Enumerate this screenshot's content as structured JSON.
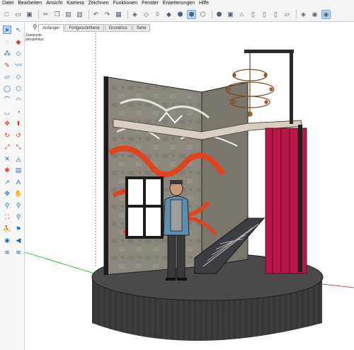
{
  "menu": [
    "Datei",
    "Bearbeiten",
    "Ansicht",
    "Kamera",
    "Zeichnen",
    "Funktionen",
    "Fenster",
    "Erweiterungen",
    "Hilfe"
  ],
  "toolbar": {
    "buttons": [
      {
        "icon": "new-file-icon",
        "glyph": "□",
        "active": false
      },
      {
        "icon": "open-folder-icon",
        "glyph": "▭",
        "active": false
      },
      {
        "icon": "save-icon",
        "glyph": "▣",
        "active": false
      },
      {
        "sep": true
      },
      {
        "icon": "cut-icon",
        "glyph": "✂",
        "active": false
      },
      {
        "icon": "copy-icon",
        "glyph": "❐",
        "active": false
      },
      {
        "icon": "paste-icon",
        "glyph": "▤",
        "active": false
      },
      {
        "icon": "erase-icon",
        "glyph": "▥",
        "active": false
      },
      {
        "sep": true
      },
      {
        "icon": "undo-icon",
        "glyph": "↶",
        "active": false
      },
      {
        "icon": "redo-icon",
        "glyph": "↷",
        "active": false
      },
      {
        "icon": "print-icon",
        "glyph": "▦",
        "active": false
      },
      {
        "sep": true
      },
      {
        "icon": "xray-icon",
        "glyph": "◈",
        "active": false
      },
      {
        "icon": "back-edges-icon",
        "glyph": "◇",
        "active": false
      },
      {
        "icon": "wireframe-icon",
        "glyph": "◊",
        "active": false
      },
      {
        "icon": "hidden-line-icon",
        "glyph": "◆",
        "active": false
      },
      {
        "icon": "shaded-icon",
        "glyph": "⬢",
        "active": false
      },
      {
        "icon": "shaded-textures-icon",
        "glyph": "⬢",
        "active": true
      },
      {
        "icon": "monochrome-icon",
        "glyph": "⬡",
        "active": false
      },
      {
        "sep": true
      },
      {
        "icon": "iso-view-icon",
        "glyph": "⬢",
        "active": false
      },
      {
        "icon": "top-view-icon",
        "glyph": "▣",
        "active": false
      },
      {
        "icon": "front-view-icon",
        "glyph": "⌂",
        "active": false
      },
      {
        "icon": "right-view-icon",
        "glyph": "▯",
        "active": false
      },
      {
        "icon": "back-view-icon",
        "glyph": "▯",
        "active": false
      },
      {
        "icon": "left-view-icon",
        "glyph": "▯",
        "active": false
      },
      {
        "icon": "bottom-view-icon",
        "glyph": "▱",
        "active": false
      },
      {
        "sep": true
      },
      {
        "icon": "section-plane-icon",
        "glyph": "◈",
        "active": false
      },
      {
        "icon": "section-cut-icon",
        "glyph": "◉",
        "active": false
      },
      {
        "icon": "section-fill-icon",
        "glyph": "◉",
        "active": true
      }
    ]
  },
  "left_tools": [
    {
      "icon": "select-arrow-icon",
      "glyph": "➤",
      "active": true
    },
    {
      "icon": "select-arrow-alt-icon",
      "glyph": "↖",
      "active": false
    },
    {
      "icon": "lasso-icon",
      "glyph": "◌",
      "active": false
    },
    {
      "icon": "paint-bucket-icon",
      "glyph": "◆",
      "active": false,
      "red": true
    },
    {
      "icon": "component-icon",
      "glyph": "⁂",
      "active": false
    },
    {
      "icon": "eraser-icon",
      "glyph": "◇",
      "active": false
    },
    {
      "icon": "pencil-icon",
      "glyph": "✎",
      "active": false,
      "red": true
    },
    {
      "icon": "freehand-icon",
      "glyph": "〰",
      "active": false
    },
    {
      "icon": "rectangle-icon",
      "glyph": "▱",
      "active": false
    },
    {
      "icon": "rotated-rect-icon",
      "glyph": "◇",
      "active": false
    },
    {
      "icon": "circle-icon",
      "glyph": "◯",
      "active": false
    },
    {
      "icon": "polygon-icon",
      "glyph": "⬡",
      "active": false
    },
    {
      "icon": "arc-icon",
      "glyph": "⌒",
      "active": false
    },
    {
      "icon": "arc-2pt-icon",
      "glyph": "◠",
      "active": false
    },
    {
      "icon": "arc-3pt-icon",
      "glyph": "◡",
      "active": false
    },
    {
      "icon": "pie-icon",
      "glyph": "◔",
      "active": false
    },
    {
      "icon": "move-icon",
      "glyph": "✥",
      "active": false,
      "red": true
    },
    {
      "icon": "push-pull-icon",
      "glyph": "⬆",
      "active": false,
      "red": true
    },
    {
      "icon": "rotate-icon",
      "glyph": "↻",
      "active": false,
      "red": true
    },
    {
      "icon": "follow-me-icon",
      "glyph": "↺",
      "active": false,
      "red": true
    },
    {
      "icon": "scale-icon",
      "glyph": "⤢",
      "active": false,
      "red": true
    },
    {
      "icon": "offset-icon",
      "glyph": "⤡",
      "active": false,
      "red": true
    },
    {
      "icon": "tape-measure-icon",
      "glyph": "✕",
      "active": false
    },
    {
      "icon": "protractor-icon",
      "glyph": "◬",
      "active": false
    },
    {
      "icon": "dimension-icon",
      "glyph": "✱",
      "active": false,
      "red": true
    },
    {
      "icon": "text-icon",
      "glyph": "▤",
      "active": false
    },
    {
      "icon": "axes-icon",
      "glyph": "↗",
      "active": false
    },
    {
      "icon": "3d-text-icon",
      "glyph": "A",
      "active": false
    },
    {
      "icon": "orbit-icon",
      "glyph": "✥",
      "active": false
    },
    {
      "icon": "pan-icon",
      "glyph": "✋",
      "active": false
    },
    {
      "icon": "zoom-icon",
      "glyph": "⚲",
      "active": false
    },
    {
      "icon": "zoom-window-icon",
      "glyph": "⚲",
      "active": false
    },
    {
      "icon": "zoom-extents-icon",
      "glyph": "⛶",
      "active": false,
      "red": true
    },
    {
      "icon": "previous-view-icon",
      "glyph": "⚲",
      "active": false
    },
    {
      "icon": "position-camera-icon",
      "glyph": "⛹",
      "active": false
    },
    {
      "icon": "walk-icon",
      "glyph": "⚑",
      "active": false
    },
    {
      "icon": "look-around-icon",
      "glyph": "◉",
      "active": false
    },
    {
      "icon": "section-icon",
      "glyph": "◀",
      "active": false
    },
    {
      "icon": "sandbox-icon",
      "glyph": "≋",
      "active": false
    },
    {
      "icon": "sandbox-scoop-icon",
      "glyph": "≋",
      "active": false
    }
  ],
  "scene_tabs": [
    "Anfänger",
    "Fortgeschrittene",
    "Grundriss",
    "Seite"
  ],
  "camera": {
    "label": "Zweipunkt\nperspektive"
  },
  "colors": {
    "wall": "#8a8478",
    "curtain": "#b8174a",
    "stair": "#2f3136",
    "stage": "#3c3c3c",
    "graffiti_red": "#e0441c",
    "axis_red": "#d11",
    "axis_green": "#1a1",
    "axis_blue": "#22a"
  }
}
